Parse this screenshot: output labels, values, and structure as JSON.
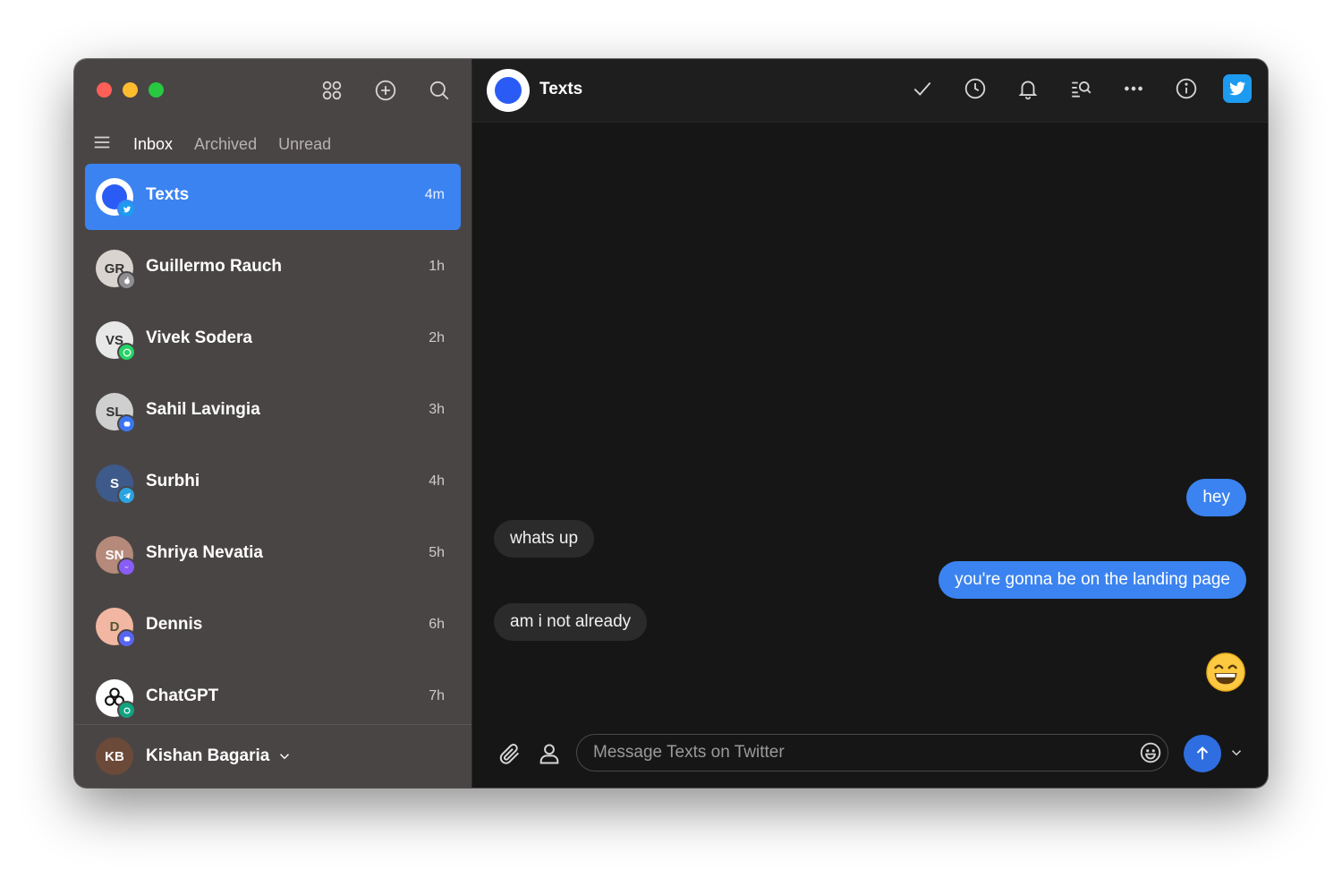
{
  "sidebar": {
    "tabs": [
      {
        "label": "Inbox",
        "active": true
      },
      {
        "label": "Archived",
        "active": false
      },
      {
        "label": "Unread",
        "active": false
      }
    ],
    "conversations": [
      {
        "name": "Texts",
        "time": "4m",
        "network": "twitter",
        "avatar_color": "#2a5cf5",
        "badge_color": "#1d9bf0"
      },
      {
        "name": "Guillermo Rauch",
        "time": "1h",
        "network": "imessage",
        "avatar_color": "#d9d4cf",
        "badge_color": "#8e8e93"
      },
      {
        "name": "Vivek Sodera",
        "time": "2h",
        "network": "whatsapp",
        "avatar_color": "#e8e8e8",
        "badge_color": "#25d366"
      },
      {
        "name": "Sahil Lavingia",
        "time": "3h",
        "network": "signal",
        "avatar_color": "#cfcfcf",
        "badge_color": "#3a76f0"
      },
      {
        "name": "Surbhi",
        "time": "4h",
        "network": "telegram",
        "avatar_color": "#3e5a8a",
        "badge_color": "#2aa3e0"
      },
      {
        "name": "Shriya Nevatia",
        "time": "5h",
        "network": "messenger",
        "avatar_color": "#b58a7a",
        "badge_color": "#8a5cf6"
      },
      {
        "name": "Dennis",
        "time": "6h",
        "network": "discord",
        "avatar_color": "#f2b7a2",
        "badge_color": "#5865f2"
      },
      {
        "name": "ChatGPT",
        "time": "7h",
        "network": "openai",
        "avatar_color": "#ffffff",
        "badge_color": "#10a37f"
      }
    ],
    "account": {
      "name": "Kishan Bagaria",
      "avatar_color": "#6b4a3a"
    }
  },
  "chat": {
    "title": "Texts",
    "messages": [
      {
        "text": "hey",
        "direction": "outgoing"
      },
      {
        "text": "whats up",
        "direction": "incoming"
      },
      {
        "text": "you're gonna be on the landing page",
        "direction": "outgoing"
      },
      {
        "text": "am i not already",
        "direction": "incoming"
      },
      {
        "emoji": "grinning-face",
        "direction": "outgoing"
      }
    ],
    "composer": {
      "placeholder": "Message Texts on Twitter"
    }
  },
  "colors": {
    "accent": "#3b83f0",
    "sidebar_bg": "#4a4545",
    "chat_bg": "#161616",
    "twitter": "#1d9bf0"
  }
}
